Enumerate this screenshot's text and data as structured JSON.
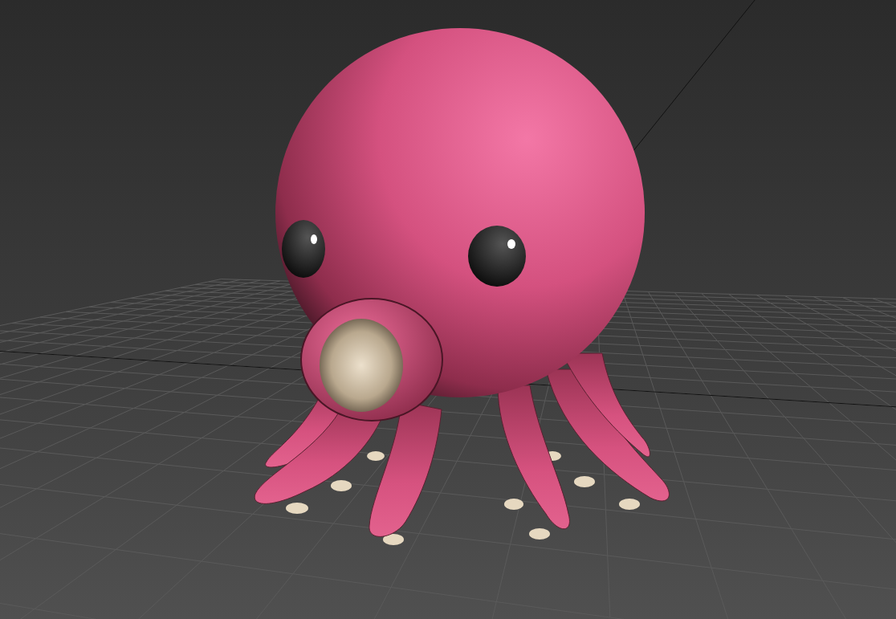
{
  "viewport": {
    "grid_visible": true
  }
}
